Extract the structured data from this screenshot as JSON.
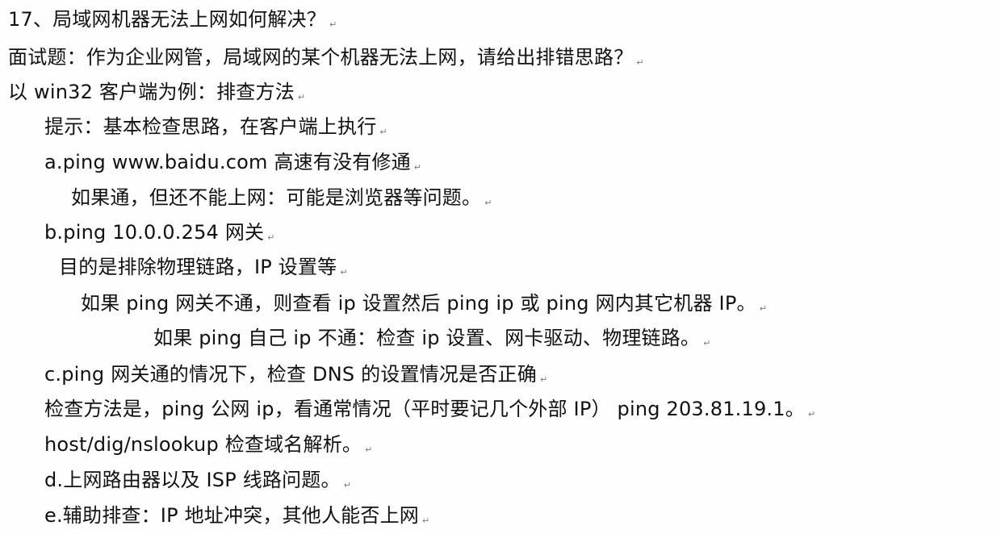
{
  "doc": {
    "line1": "17、局域网机器无法上网如何解决？",
    "line2": "面试题：作为企业网管，局域网的某个机器无法上网，请给出排错思路？",
    "line3": "以 win32 客户端为例：排查方法",
    "line4": "提示：基本检查思路，在客户端上执行",
    "line5": "a.ping www.baidu.com  高速有没有修通",
    "line6": "如果通，但还不能上网：可能是浏览器等问题。",
    "line7": "b.ping 10.0.0.254  网关",
    "line8": "目的是排除物理链路，IP 设置等",
    "line9": "如果 ping 网关不通，则查看 ip 设置然后 ping ip 或 ping 网内其它机器 IP。",
    "line10": "如果 ping 自己 ip 不通：检查 ip 设置、网卡驱动、物理链路。",
    "line11": "c.ping 网关通的情况下，检查 DNS 的设置情况是否正确",
    "line12": "检查方法是，ping 公网 ip，看通常情况（平时要记几个外部 IP）  ping 203.81.19.1。",
    "line13": "host/dig/nslookup 检查域名解析。",
    "line14": "d.上网路由器以及 ISP 线路问题。",
    "line15": "e.辅助排查：IP 地址冲突，其他人能否上网",
    "paragraph_mark": "↵"
  }
}
